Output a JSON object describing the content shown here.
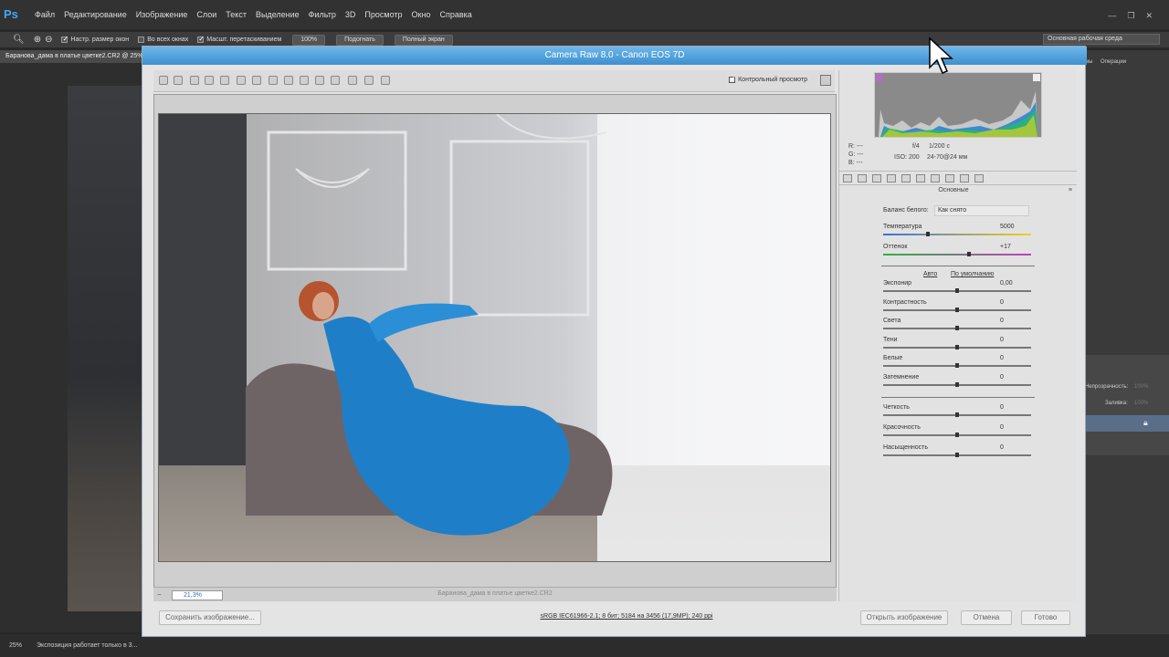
{
  "ps": {
    "logo": "Ps",
    "menu": [
      "Файл",
      "Редактирование",
      "Изображение",
      "Слои",
      "Текст",
      "Выделение",
      "Фильтр",
      "3D",
      "Просмотр",
      "Окно",
      "Справка"
    ],
    "options": {
      "resize_windows": "Настр. размер окон",
      "all_windows": "Во всех окнах",
      "scrubby_zoom": "Масшт. перетаскиванием",
      "btn_100": "100%",
      "btn_fit": "Подогнать",
      "btn_full": "Полный экран",
      "workspace": "Основная рабочая среда"
    },
    "doc_tab": "Баранова_дама в платье цветке2.CR2 @ 25%",
    "right_tabs": [
      "мы",
      "Операции"
    ],
    "layers_labels": [
      "Непрозрачность:",
      "100%",
      "Заливка:",
      "100%"
    ],
    "status": {
      "zoom": "25%",
      "message": "Экспозиция работает только в 3..."
    }
  },
  "acr": {
    "title": "Camera Raw 8.0  -  Canon EOS 7D",
    "preview_label": "Контрольный просмотр",
    "zoom": "21,3%",
    "filename": "Баранова_дама в платье цветке2.CR2",
    "camera_info": {
      "r": "R:  ---",
      "g": "G:  ---",
      "b": "B:  ---",
      "aperture": "f/4",
      "shutter": "1/200 с",
      "iso": "ISO: 200",
      "lens": "24-70@24 мм"
    },
    "panel_title": "Основные",
    "wb_label": "Баланс белого:",
    "wb_value": "Как снято",
    "temperature": {
      "label": "Температура",
      "value": "5000",
      "pos": 0.3
    },
    "tint": {
      "label": "Оттенок",
      "value": "+17",
      "pos": 0.58
    },
    "auto_link": "Авто",
    "default_link": "По умолчанию",
    "sliders": [
      {
        "label": "Экспонир",
        "value": "0,00",
        "pos": 0.5
      },
      {
        "label": "Контрастность",
        "value": "0",
        "pos": 0.5
      },
      {
        "label": "Света",
        "value": "0",
        "pos": 0.5
      },
      {
        "label": "Тени",
        "value": "0",
        "pos": 0.5
      },
      {
        "label": "Белые",
        "value": "0",
        "pos": 0.5
      },
      {
        "label": "Затемнение",
        "value": "0",
        "pos": 0.5
      }
    ],
    "sliders2": [
      {
        "label": "Четкость",
        "value": "0",
        "pos": 0.5
      },
      {
        "label": "Красочность",
        "value": "0",
        "pos": 0.5
      },
      {
        "label": "Насыщенность",
        "value": "0",
        "pos": 0.5
      }
    ],
    "save_button": "Сохранить изображение...",
    "workflow_link": "sRGB IEC61966-2.1; 8 бит; 5184 на 3456 (17,9МР); 240 ppi",
    "open_button": "Открыть изображение",
    "cancel_button": "Отмена",
    "done_button": "Готово"
  }
}
